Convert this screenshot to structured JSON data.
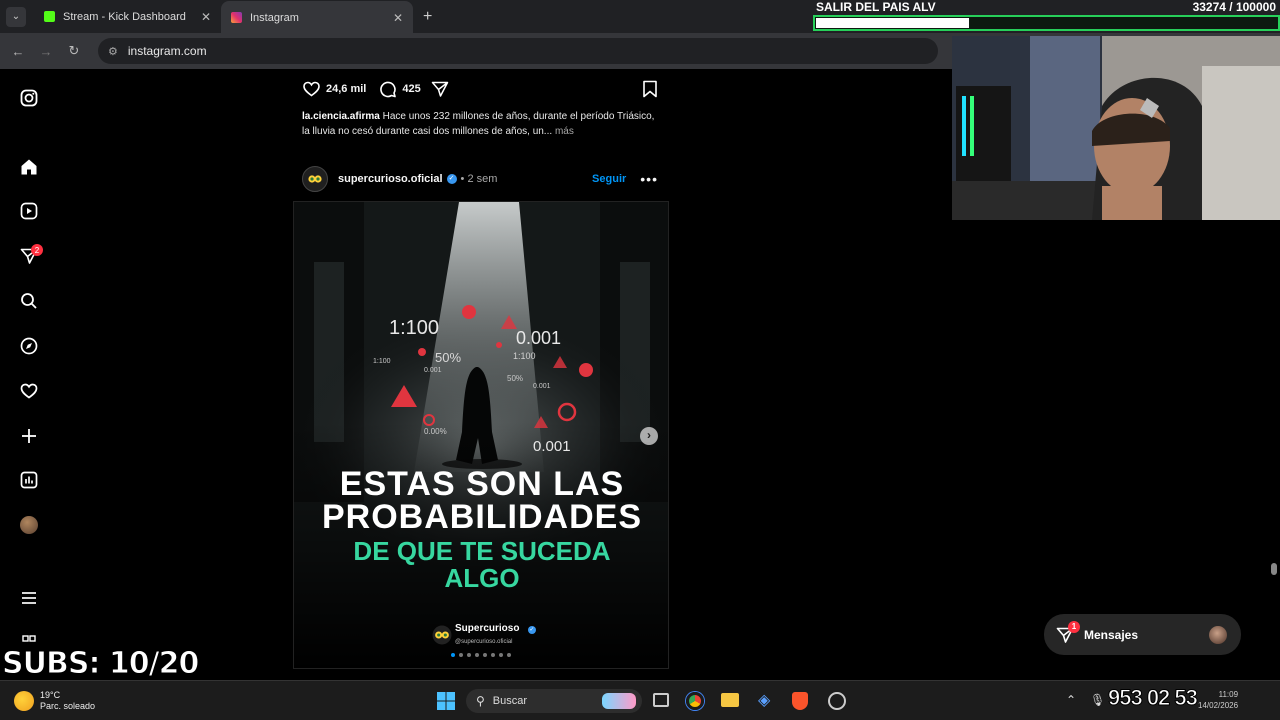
{
  "browser": {
    "tabs": [
      {
        "title": "Stream - Kick Dashboard",
        "favicon_color": "#53fc18"
      },
      {
        "title": "Instagram",
        "favicon_color": "#e1306c",
        "active": true
      }
    ],
    "url": "instagram.com"
  },
  "prev_post": {
    "likes": "24,6 mil",
    "comments": "425",
    "caption_user": "la.ciencia.afirma",
    "caption_text": "Hace unos 232 millones de años, durante el período Triásico, la lluvia no cesó durante casi dos millones de años, un...",
    "more": "más"
  },
  "post": {
    "user": "supercurioso.oficial",
    "time": "• 2 sem",
    "follow": "Seguir",
    "image": {
      "stats": [
        "1:100",
        "0.001",
        "50%",
        "1:100",
        "0.001",
        "1:100",
        "50%",
        "0.001",
        "0.00%",
        "0.001"
      ],
      "headline1_a": "ESTAS SON LAS",
      "headline1_b": "PROBABILIDADES",
      "headline2_a": "DE QUE TE SUCEDA",
      "headline2_b": "ALGO",
      "brand": "Supercurioso",
      "brand_handle": "@supercurioso.oficial"
    }
  },
  "sidebar": {
    "notification_count": "2"
  },
  "messages": {
    "label": "Mensajes",
    "count": "1"
  },
  "stream_overlay": {
    "goal_title": "SALIR DEL PAIS ALV",
    "goal_count": "33274  / 100000",
    "goal_progress": 0.33274,
    "subs": "SUBS: 10/20"
  },
  "taskbar": {
    "weather_temp": "19°C",
    "weather_desc": "Parc. soleado",
    "search": "Buscar",
    "clock_overlay": "953 02 53",
    "time": "11:09",
    "date": "14/02/2026"
  },
  "colors": {
    "accent": "#0095f6",
    "headline_green": "#37d7a0",
    "badge": "#ff3040"
  }
}
